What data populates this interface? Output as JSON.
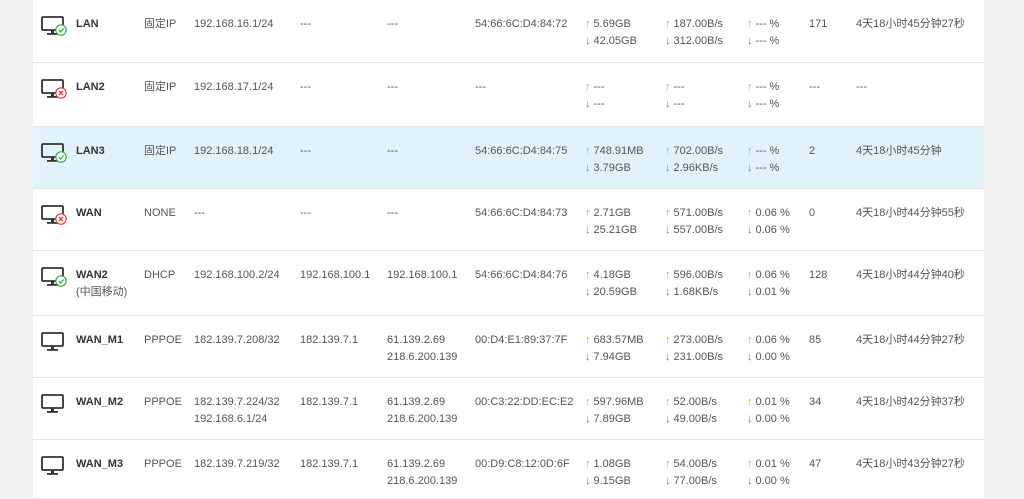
{
  "colors": {
    "up": "#f39a2c",
    "down": "#33a34b",
    "ok": "#2fae4b",
    "err": "#e04040",
    "selected_row": "#e2f2fb"
  },
  "rows": [
    {
      "name": "LAN",
      "sub": "",
      "status": "ok",
      "mode": "固定IP",
      "ip": [
        "192.168.16.1/24"
      ],
      "gateway": "---",
      "dns": [
        "---"
      ],
      "mac": "54:66:6C:D4:84:72",
      "traffic_up": "5.69GB",
      "traffic_down": "42.05GB",
      "rate_up": "187.00B/s",
      "rate_down": "312.00B/s",
      "loss_up": "--- %",
      "loss_down": "--- %",
      "conn": "171",
      "uptime": "4天18小时45分钟27秒"
    },
    {
      "name": "LAN2",
      "sub": "",
      "status": "err",
      "mode": "固定IP",
      "ip": [
        "192.168.17.1/24"
      ],
      "gateway": "---",
      "dns": [
        "---"
      ],
      "mac": "---",
      "traffic_up": "---",
      "traffic_down": "---",
      "rate_up": "---",
      "rate_down": "---",
      "loss_up": "--- %",
      "loss_down": "--- %",
      "conn": "---",
      "uptime": "---"
    },
    {
      "name": "LAN3",
      "sub": "",
      "status": "ok",
      "mode": "固定IP",
      "ip": [
        "192.168.18.1/24"
      ],
      "gateway": "---",
      "dns": [
        "---"
      ],
      "mac": "54:66:6C:D4:84:75",
      "traffic_up": "748.91MB",
      "traffic_down": "3.79GB",
      "rate_up": "702.00B/s",
      "rate_down": "2.96KB/s",
      "loss_up": "--- %",
      "loss_down": "--- %",
      "conn": "2",
      "uptime": "4天18小时45分钟"
    },
    {
      "name": "WAN",
      "sub": "",
      "status": "err",
      "mode": "NONE",
      "ip": [
        "---"
      ],
      "gateway": "---",
      "dns": [
        "---"
      ],
      "mac": "54:66:6C:D4:84:73",
      "traffic_up": "2.71GB",
      "traffic_down": "25.21GB",
      "rate_up": "571.00B/s",
      "rate_down": "557.00B/s",
      "loss_up": "0.06 %",
      "loss_down": "0.06 %",
      "conn": "0",
      "uptime": "4天18小时44分钟55秒"
    },
    {
      "name": "WAN2",
      "sub": "(中国移动)",
      "status": "ok",
      "mode": "DHCP",
      "ip": [
        "192.168.100.2/24"
      ],
      "gateway": "192.168.100.1",
      "dns": [
        "192.168.100.1"
      ],
      "mac": "54:66:6C:D4:84:76",
      "traffic_up": "4.18GB",
      "traffic_down": "20.59GB",
      "rate_up": "596.00B/s",
      "rate_down": "1.68KB/s",
      "loss_up": "0.06 %",
      "loss_down": "0.01 %",
      "conn": "128",
      "uptime": "4天18小时44分钟40秒"
    },
    {
      "name": "WAN_M1",
      "sub": "",
      "status": "plain",
      "mode": "PPPOE",
      "ip": [
        "182.139.7.208/32"
      ],
      "gateway": "182.139.7.1",
      "dns": [
        "61.139.2.69",
        "218.6.200.139"
      ],
      "mac": "00:D4:E1:89:37:7F",
      "traffic_up": "683.57MB",
      "traffic_down": "7.94GB",
      "rate_up": "273.00B/s",
      "rate_down": "231.00B/s",
      "loss_up": "0.06 %",
      "loss_down": "0.00 %",
      "conn": "85",
      "uptime": "4天18小时44分钟27秒"
    },
    {
      "name": "WAN_M2",
      "sub": "",
      "status": "plain",
      "mode": "PPPOE",
      "ip": [
        "182.139.7.224/32",
        "192.168.6.1/24"
      ],
      "gateway": "182.139.7.1",
      "dns": [
        "61.139.2.69",
        "218.6.200.139"
      ],
      "mac": "00:C3:22:DD:EC:E2",
      "traffic_up": "597.96MB",
      "traffic_down": "7.89GB",
      "rate_up": "52.00B/s",
      "rate_down": "49.00B/s",
      "loss_up": "0.01 %",
      "loss_down": "0.00 %",
      "conn": "34",
      "uptime": "4天18小时42分钟37秒"
    },
    {
      "name": "WAN_M3",
      "sub": "",
      "status": "plain",
      "mode": "PPPOE",
      "ip": [
        "182.139.7.219/32"
      ],
      "gateway": "182.139.7.1",
      "dns": [
        "61.139.2.69",
        "218.6.200.139"
      ],
      "mac": "00:D9:C8:12:0D:6F",
      "traffic_up": "1.08GB",
      "traffic_down": "9.15GB",
      "rate_up": "54.00B/s",
      "rate_down": "77.00B/s",
      "loss_up": "0.01 %",
      "loss_down": "0.00 %",
      "conn": "47",
      "uptime": "4天18小时43分钟27秒"
    }
  ]
}
